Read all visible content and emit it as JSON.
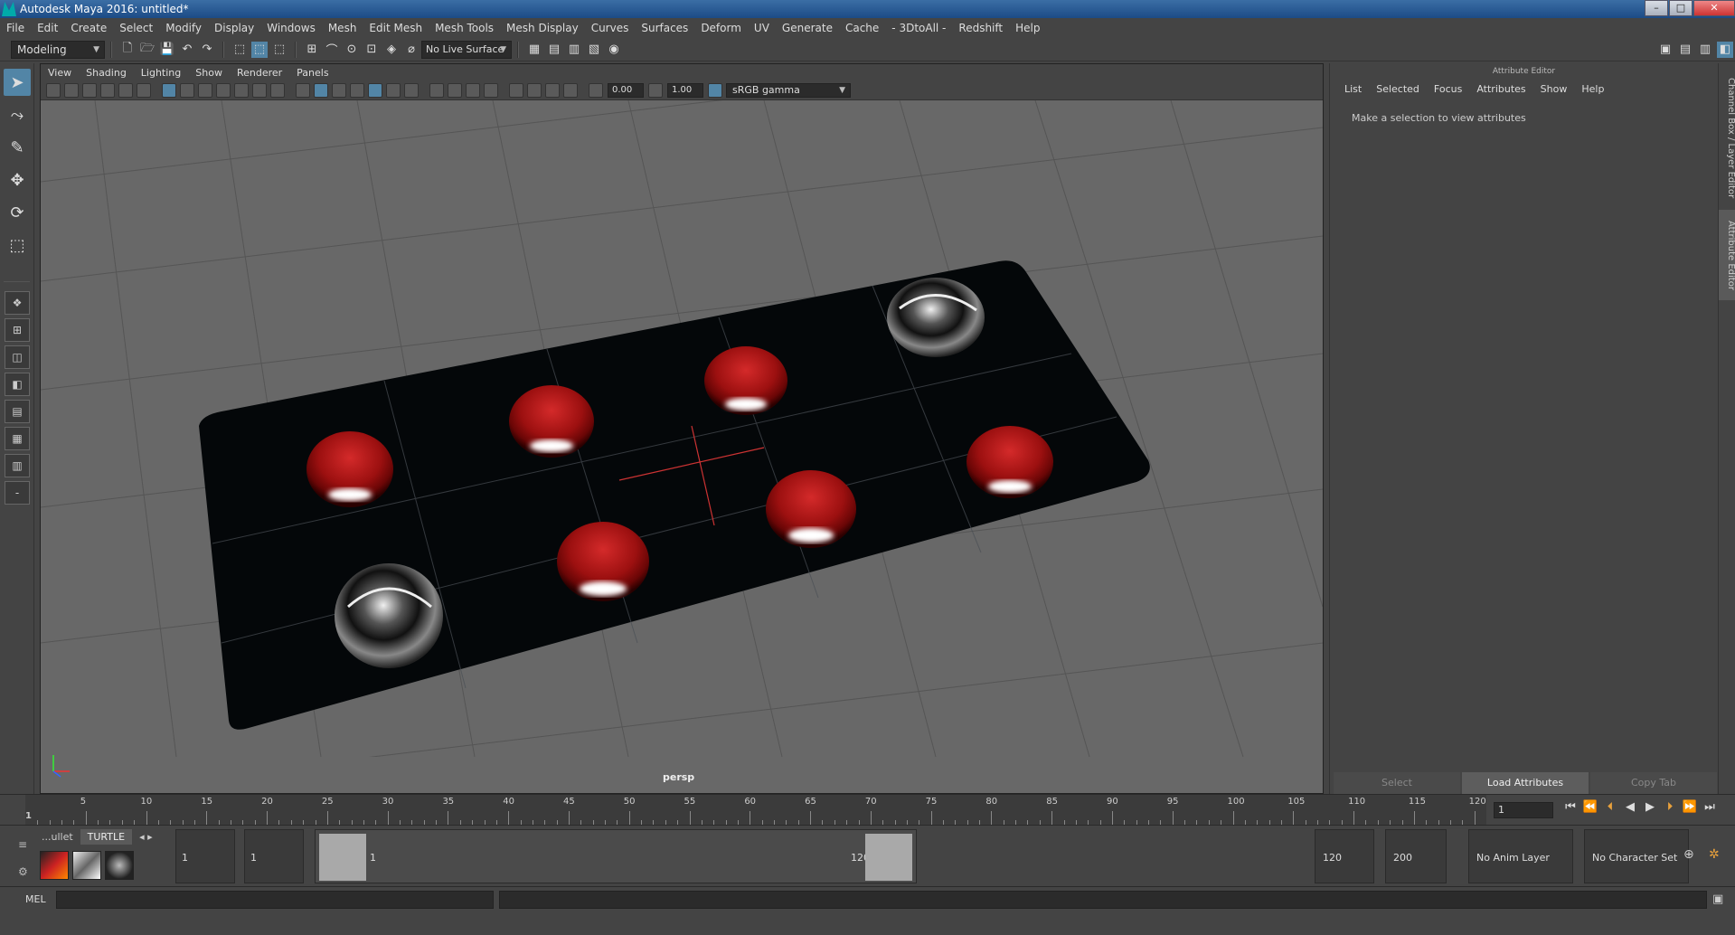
{
  "window": {
    "title": "Autodesk Maya 2016: untitled*"
  },
  "menubar": [
    "File",
    "Edit",
    "Create",
    "Select",
    "Modify",
    "Display",
    "Windows",
    "Mesh",
    "Edit Mesh",
    "Mesh Tools",
    "Mesh Display",
    "Curves",
    "Surfaces",
    "Deform",
    "UV",
    "Generate",
    "Cache",
    "- 3DtoAll -",
    "Redshift",
    "Help"
  ],
  "toolbar": {
    "mode": "Modeling",
    "live_surface": "No Live Surface"
  },
  "viewport": {
    "menu": [
      "View",
      "Shading",
      "Lighting",
      "Show",
      "Renderer",
      "Panels"
    ],
    "exposure": "0.00",
    "gamma": "1.00",
    "color_space": "sRGB gamma",
    "camera": "persp",
    "colors": {
      "ground": "#686868",
      "board": "#040709",
      "red_piece": "#b51818",
      "chrome_piece": "#9aa0a6"
    }
  },
  "attribute_editor": {
    "header": "Attribute Editor",
    "menu": [
      "List",
      "Selected",
      "Focus",
      "Attributes",
      "Show",
      "Help"
    ],
    "message": "Make a selection to view attributes",
    "buttons": [
      "Select",
      "Load Attributes",
      "Copy Tab"
    ]
  },
  "side_tabs": {
    "channel_box": "Channel Box / Layer Editor",
    "attribute_editor": "Attribute Editor"
  },
  "timeline": {
    "start_label": "1",
    "labels": [
      "5",
      "10",
      "15",
      "20",
      "25",
      "30",
      "35",
      "40",
      "45",
      "50",
      "55",
      "60",
      "65",
      "70",
      "75",
      "80",
      "85",
      "90",
      "95",
      "100",
      "105",
      "110",
      "115",
      "120"
    ],
    "current_frame": "1"
  },
  "range": {
    "shelf_tabs": [
      "...ullet",
      "TURTLE"
    ],
    "start": "1",
    "playback_start": "1",
    "inner_start": "1",
    "inner_end": "120",
    "playback_end": "120",
    "end": "200",
    "anim_layer": "No Anim Layer",
    "character_set": "No Character Set"
  },
  "command_line": {
    "language": "MEL"
  }
}
